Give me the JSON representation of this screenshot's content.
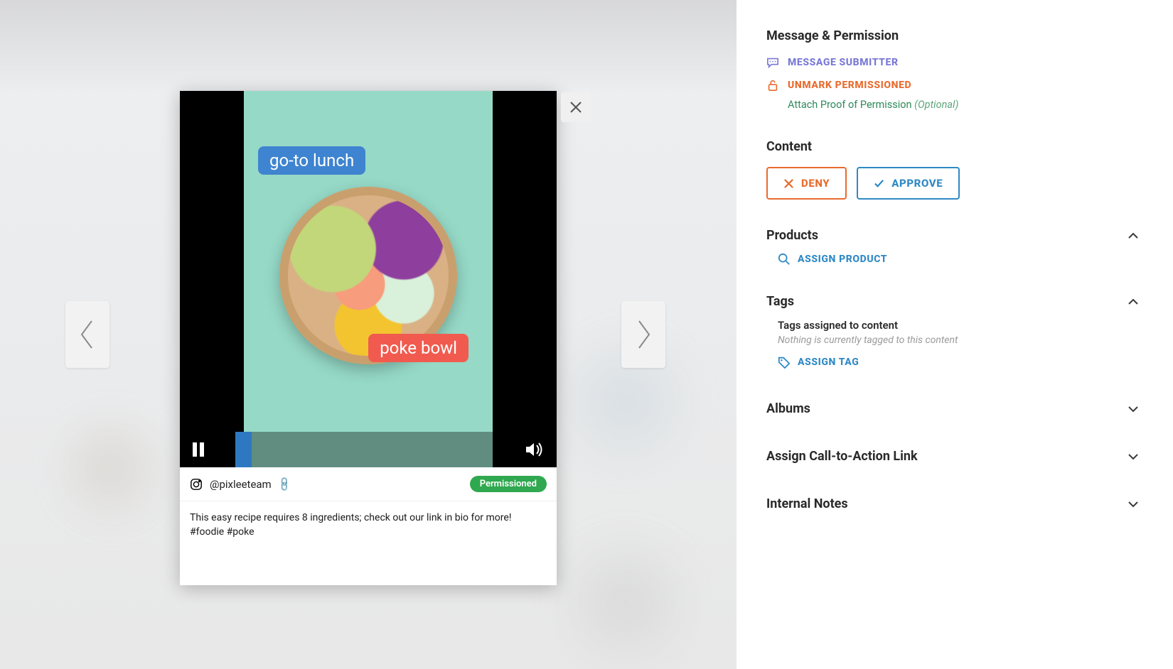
{
  "media": {
    "tag_top": "go-to lunch",
    "tag_bottom": "poke bowl",
    "progress_pct": 6,
    "handle": "@pixleeteam",
    "permission_badge": "Permissioned",
    "caption": "This easy recipe requires 8 ingredients; check out our link in bio for more! #foodie #poke"
  },
  "sidebar": {
    "message_permission": {
      "title": "Message & Permission",
      "message_submitter": "MESSAGE SUBMITTER",
      "unmark_permissioned": "UNMARK PERMISSIONED",
      "attach_proof": "Attach Proof of Permission",
      "attach_proof_optional": "(Optional)"
    },
    "content": {
      "title": "Content",
      "deny": "DENY",
      "approve": "APPROVE"
    },
    "products": {
      "title": "Products",
      "assign": "ASSIGN PRODUCT"
    },
    "tags": {
      "title": "Tags",
      "assigned_label": "Tags assigned to content",
      "empty": "Nothing is currently tagged to this content",
      "assign": "ASSIGN TAG"
    },
    "albums": {
      "title": "Albums"
    },
    "cta": {
      "title": "Assign Call-to-Action Link"
    },
    "notes": {
      "title": "Internal Notes"
    }
  }
}
